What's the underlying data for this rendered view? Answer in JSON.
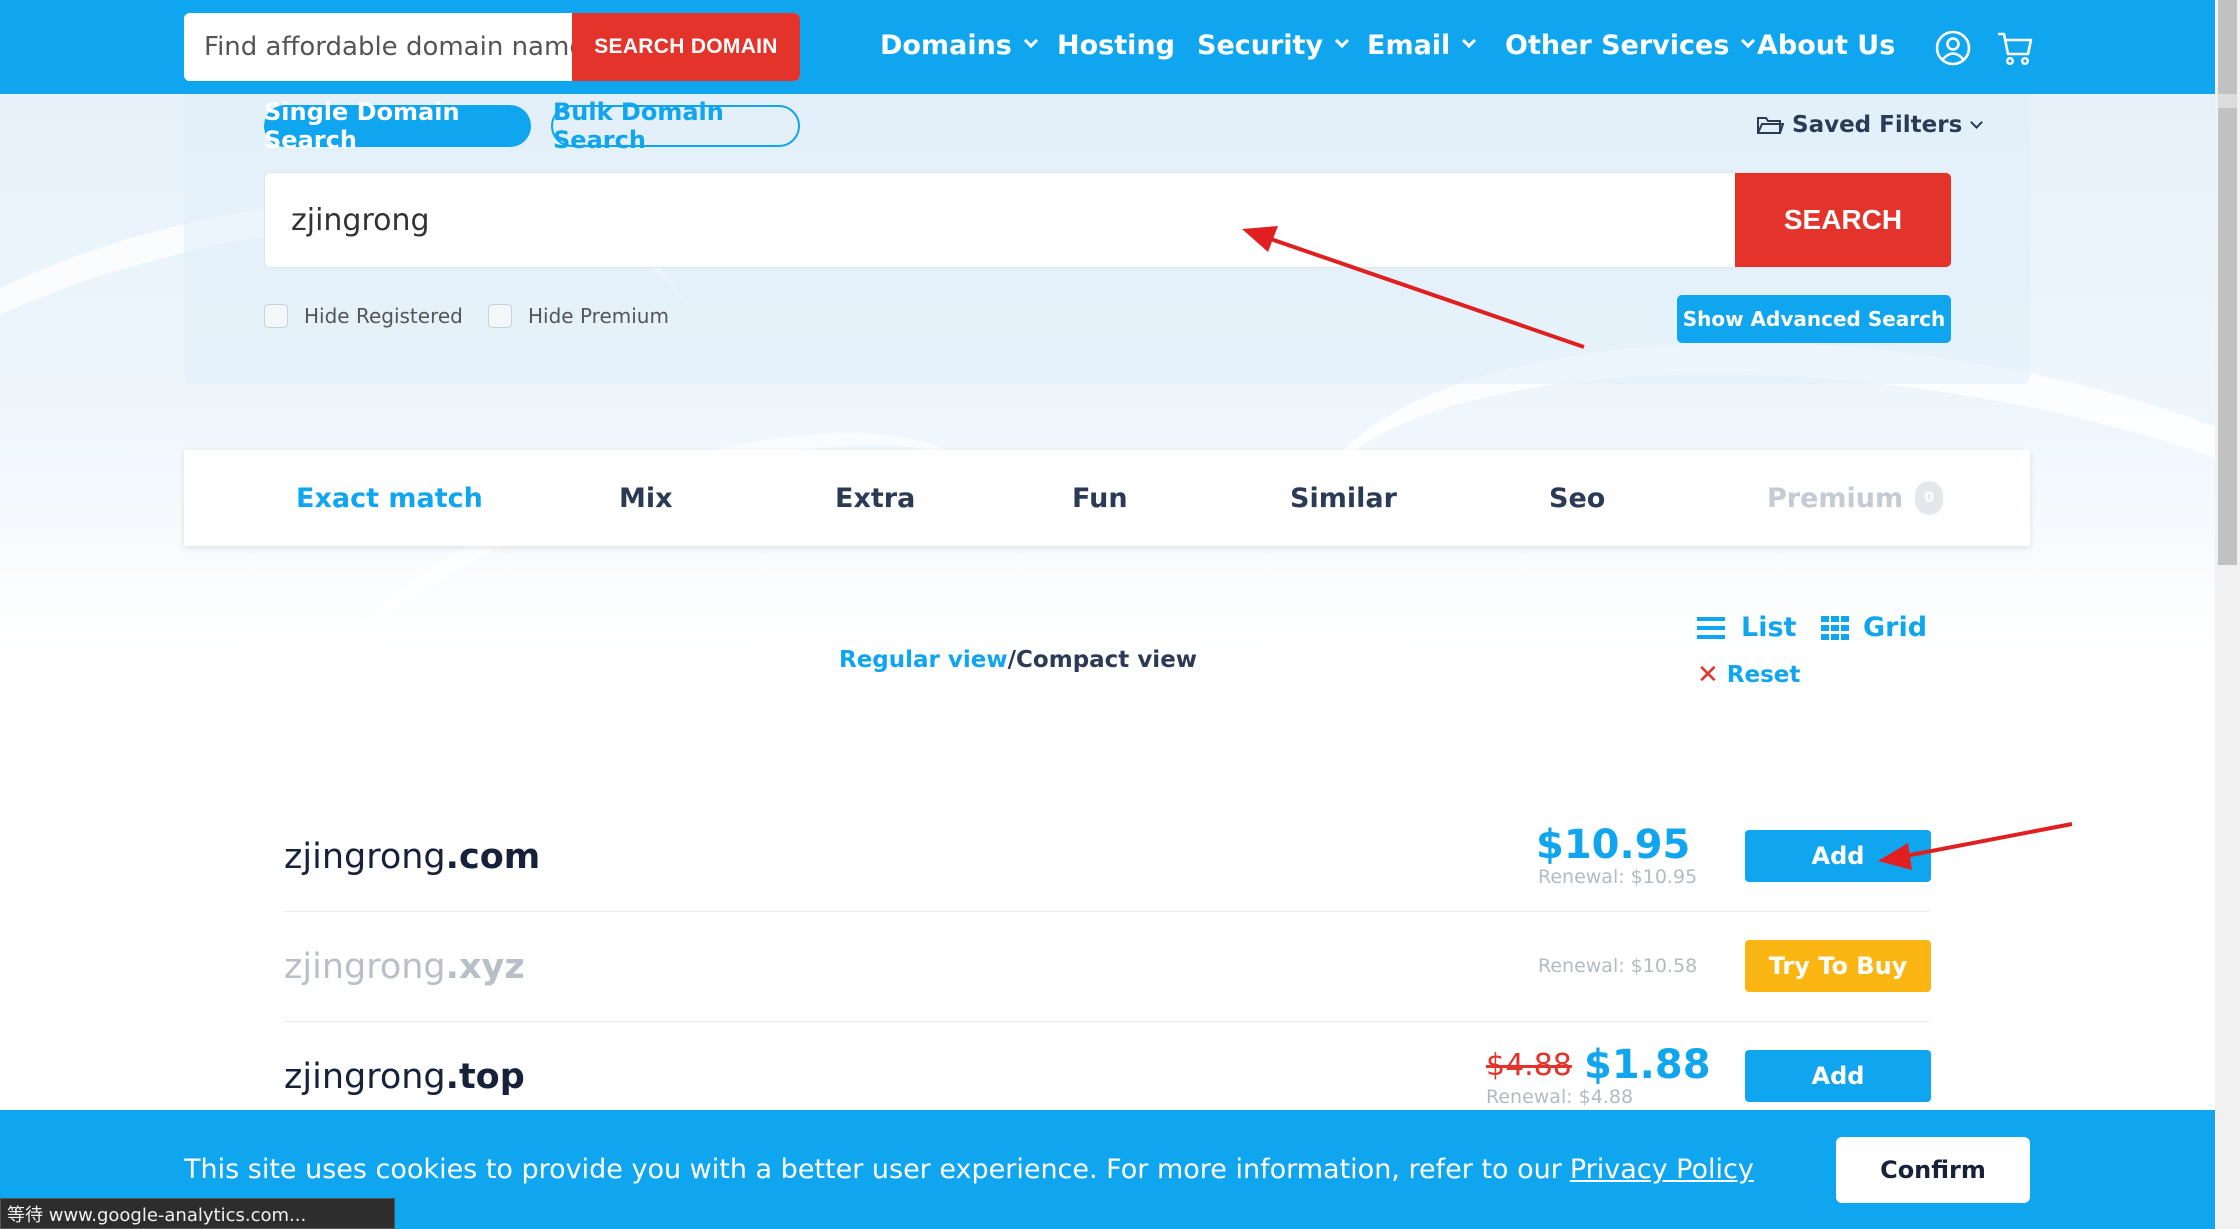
{
  "header": {
    "search_placeholder": "Find affordable domain name",
    "search_button": "SEARCH DOMAIN",
    "nav": [
      {
        "label": "Domains",
        "dropdown": true
      },
      {
        "label": "Hosting",
        "dropdown": false
      },
      {
        "label": "Security",
        "dropdown": true
      },
      {
        "label": "Email",
        "dropdown": true
      },
      {
        "label": "Other Services",
        "dropdown": true
      },
      {
        "label": "About Us",
        "dropdown": false
      }
    ],
    "icons": [
      "user-icon",
      "cart-icon"
    ]
  },
  "search_panel": {
    "mode_single": "Single Domain Search",
    "mode_bulk": "Bulk Domain Search",
    "saved_filters": "Saved Filters",
    "query": "zjingrong",
    "search_button": "SEARCH",
    "hide_registered": "Hide Registered",
    "hide_premium": "Hide Premium",
    "advanced_button": "Show Advanced Search"
  },
  "tabs": [
    {
      "label": "Exact match",
      "active": true
    },
    {
      "label": "Mix"
    },
    {
      "label": "Extra"
    },
    {
      "label": "Fun"
    },
    {
      "label": "Similar"
    },
    {
      "label": "Seo"
    },
    {
      "label": "Premium",
      "count": "0",
      "muted": true
    }
  ],
  "view": {
    "regular": "Regular view",
    "separator": "/",
    "compact": "Compact view",
    "list": "List",
    "grid": "Grid",
    "reset": "Reset"
  },
  "results": [
    {
      "name": "zjingrong",
      "tld": ".com",
      "price": "$10.95",
      "renewal": "Renewal: $10.95",
      "action": "Add"
    },
    {
      "name": "zjingrong",
      "tld": ".xyz",
      "renewal": "Renewal: $10.58",
      "action": "Try To Buy"
    },
    {
      "name": "zjingrong",
      "tld": ".top",
      "old_price": "$4.88",
      "price": "$1.88",
      "renewal": "Renewal: $4.88",
      "action": "Add"
    }
  ],
  "cookie": {
    "message": "This site uses cookies to provide you with a better user experience. For more information, refer to our",
    "link": "Privacy Policy",
    "confirm": "Confirm"
  },
  "status_bar": "等待 www.google-analytics.com...",
  "colors": {
    "brand_blue": "#10a5ef",
    "red": "#e4332b",
    "orange": "#fbb614",
    "annotation_arrow": "#e02020"
  }
}
